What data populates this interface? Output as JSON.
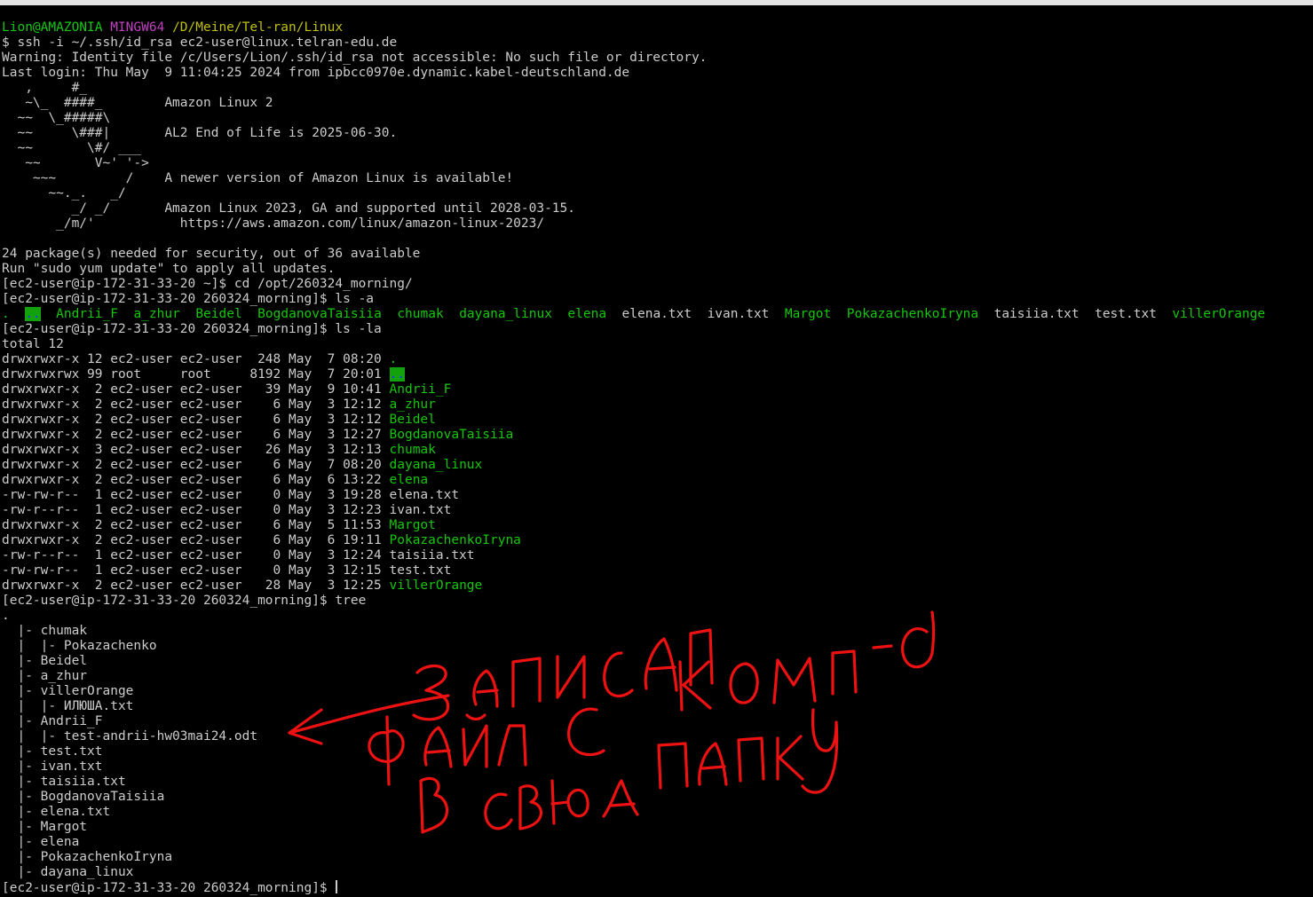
{
  "window": {
    "title": "MINGW64:/D/Meine/Tel-ran/Linux",
    "background": "#000000",
    "foreground": "#cccccc"
  },
  "colors": {
    "green": "#13c713",
    "magenta": "#c13fc1",
    "yellow": "#c1bf0e",
    "dir": "#16c60c",
    "other_writable_bg": "#13a10e",
    "other_writable_fg": "#1a33ff",
    "annotation": "#ee1111"
  },
  "lines": [
    [
      {
        "t": "Lion@AMAZONIA ",
        "c": "green"
      },
      {
        "t": "MINGW64 ",
        "c": "magenta"
      },
      {
        "t": "/D/Meine/Tel-ran/Linux",
        "c": "yellow"
      }
    ],
    [
      {
        "t": "$ ssh -i ~/.ssh/id_rsa ec2-user@linux.telran-edu.de"
      }
    ],
    [
      {
        "t": "Warning: Identity file /c/Users/Lion/.ssh/id_rsa not accessible: No such file or directory."
      }
    ],
    [
      {
        "t": "Last login: Thu May  9 11:04:25 2024 from ipbcc0970e.dynamic.kabel-deutschland.de"
      }
    ],
    [
      {
        "t": "   ,     #_"
      }
    ],
    [
      {
        "t": "   ~\\_  ####_        Amazon Linux 2"
      }
    ],
    [
      {
        "t": "  ~~  \\_#####\\"
      }
    ],
    [
      {
        "t": "  ~~     \\###|       AL2 End of Life is 2025-06-30."
      }
    ],
    [
      {
        "t": "  ~~       \\#/ ___"
      }
    ],
    [
      {
        "t": "   ~~       V~' '->"
      }
    ],
    [
      {
        "t": "    ~~~         /    A newer version of Amazon Linux is available!"
      }
    ],
    [
      {
        "t": "      ~~._.   _/"
      }
    ],
    [
      {
        "t": "         _/ _/       Amazon Linux 2023, GA and supported until 2028-03-15."
      }
    ],
    [
      {
        "t": "       _/m/'           https://aws.amazon.com/linux/amazon-linux-2023/"
      }
    ],
    [
      {
        "t": ""
      }
    ],
    [
      {
        "t": "24 package(s) needed for security, out of 36 available"
      }
    ],
    [
      {
        "t": "Run \"sudo yum update\" to apply all updates."
      }
    ],
    [
      {
        "t": "[ec2-user@ip-172-31-33-20 ~]$ cd /opt/260324_morning/"
      }
    ],
    [
      {
        "t": "[ec2-user@ip-172-31-33-20 260324_morning]$ ls -a"
      }
    ],
    [
      {
        "t": ".",
        "c": "dir"
      },
      {
        "t": "  "
      },
      {
        "t": "..",
        "c": "ow"
      },
      {
        "t": "  "
      },
      {
        "t": "Andrii_F",
        "c": "dir"
      },
      {
        "t": "  "
      },
      {
        "t": "a_zhur",
        "c": "dir"
      },
      {
        "t": "  "
      },
      {
        "t": "Beidel",
        "c": "dir"
      },
      {
        "t": "  "
      },
      {
        "t": "BogdanovaTaisiia",
        "c": "dir"
      },
      {
        "t": "  "
      },
      {
        "t": "chumak",
        "c": "dir"
      },
      {
        "t": "  "
      },
      {
        "t": "dayana_linux",
        "c": "dir"
      },
      {
        "t": "  "
      },
      {
        "t": "elena",
        "c": "dir"
      },
      {
        "t": "  elena.txt  ivan.txt  "
      },
      {
        "t": "Margot",
        "c": "dir"
      },
      {
        "t": "  "
      },
      {
        "t": "PokazachenkoIryna",
        "c": "dir"
      },
      {
        "t": "  taisiia.txt  test.txt  "
      },
      {
        "t": "villerOrange",
        "c": "dir"
      }
    ],
    [
      {
        "t": "[ec2-user@ip-172-31-33-20 260324_morning]$ ls -la"
      }
    ],
    [
      {
        "t": "total 12"
      }
    ],
    [
      {
        "t": "drwxrwxr-x 12 ec2-user ec2-user  248 May  7 08:20 "
      },
      {
        "t": ".",
        "c": "dir"
      }
    ],
    [
      {
        "t": "drwxrwxrwx 99 root     root     8192 May  7 20:01 "
      },
      {
        "t": "..",
        "c": "ow"
      }
    ],
    [
      {
        "t": "drwxrwxr-x  2 ec2-user ec2-user   39 May  9 10:41 "
      },
      {
        "t": "Andrii_F",
        "c": "dir"
      }
    ],
    [
      {
        "t": "drwxrwxr-x  2 ec2-user ec2-user    6 May  3 12:12 "
      },
      {
        "t": "a_zhur",
        "c": "dir"
      }
    ],
    [
      {
        "t": "drwxrwxr-x  2 ec2-user ec2-user    6 May  3 12:12 "
      },
      {
        "t": "Beidel",
        "c": "dir"
      }
    ],
    [
      {
        "t": "drwxrwxr-x  2 ec2-user ec2-user    6 May  3 12:27 "
      },
      {
        "t": "BogdanovaTaisiia",
        "c": "dir"
      }
    ],
    [
      {
        "t": "drwxrwxr-x  3 ec2-user ec2-user   26 May  3 12:13 "
      },
      {
        "t": "chumak",
        "c": "dir"
      }
    ],
    [
      {
        "t": "drwxrwxr-x  2 ec2-user ec2-user    6 May  7 08:20 "
      },
      {
        "t": "dayana_linux",
        "c": "dir"
      }
    ],
    [
      {
        "t": "drwxrwxr-x  2 ec2-user ec2-user    6 May  6 13:22 "
      },
      {
        "t": "elena",
        "c": "dir"
      }
    ],
    [
      {
        "t": "-rw-rw-r--  1 ec2-user ec2-user    0 May  3 19:28 elena.txt"
      }
    ],
    [
      {
        "t": "-rw-r--r--  1 ec2-user ec2-user    0 May  3 12:23 ivan.txt"
      }
    ],
    [
      {
        "t": "drwxrwxr-x  2 ec2-user ec2-user    6 May  5 11:53 "
      },
      {
        "t": "Margot",
        "c": "dir"
      }
    ],
    [
      {
        "t": "drwxrwxr-x  2 ec2-user ec2-user    6 May  6 19:11 "
      },
      {
        "t": "PokazachenkoIryna",
        "c": "dir"
      }
    ],
    [
      {
        "t": "-rw-r--r--  1 ec2-user ec2-user    0 May  3 12:24 taisiia.txt"
      }
    ],
    [
      {
        "t": "-rw-rw-r--  1 ec2-user ec2-user    0 May  3 12:15 test.txt"
      }
    ],
    [
      {
        "t": "drwxrwxr-x  2 ec2-user ec2-user   28 May  3 12:25 "
      },
      {
        "t": "villerOrange",
        "c": "dir"
      }
    ],
    [
      {
        "t": "[ec2-user@ip-172-31-33-20 260324_morning]$ tree"
      }
    ],
    [
      {
        "t": "."
      }
    ],
    [
      {
        "t": "  |- chumak"
      }
    ],
    [
      {
        "t": "  |  |- Pokazachenko"
      }
    ],
    [
      {
        "t": "  |- Beidel"
      }
    ],
    [
      {
        "t": "  |- a_zhur"
      }
    ],
    [
      {
        "t": "  |- villerOrange"
      }
    ],
    [
      {
        "t": "  |  |- ИЛЮША.txt"
      }
    ],
    [
      {
        "t": "  |- Andrii_F"
      }
    ],
    [
      {
        "t": "  |  |- test-andrii-hw03mai24.odt"
      }
    ],
    [
      {
        "t": "  |- test.txt"
      }
    ],
    [
      {
        "t": "  |- ivan.txt"
      }
    ],
    [
      {
        "t": "  |- taisiia.txt"
      }
    ],
    [
      {
        "t": "  |- BogdanovaTaisiia"
      }
    ],
    [
      {
        "t": "  |- elena.txt"
      }
    ],
    [
      {
        "t": "  |- Margot"
      }
    ],
    [
      {
        "t": "  |- elena"
      }
    ],
    [
      {
        "t": "  |- PokazachenkoIryna"
      }
    ],
    [
      {
        "t": "  |- dayana_linux"
      }
    ],
    [
      {
        "t": "[ec2-user@ip-172-31-33-20 260324_morning]$ ",
        "cursor": true
      }
    ]
  ],
  "annotation": {
    "lines": [
      "записал",
      "файл с комп-а",
      "в свою папку"
    ]
  }
}
